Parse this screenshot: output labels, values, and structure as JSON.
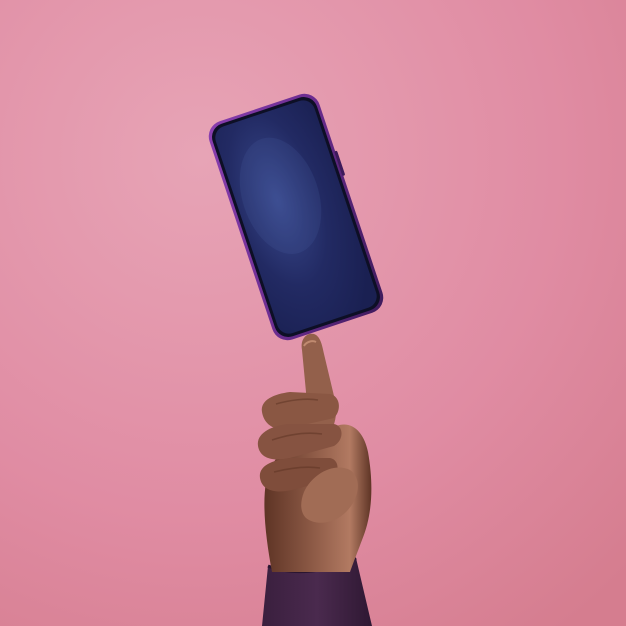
{
  "scene": {
    "background_color": "#e08ca3",
    "background_highlight": "#e7a4b6",
    "background_shadow": "#d57d8f",
    "phone_frame_color": "#6b2c8f",
    "phone_screen_color": "#1a2052",
    "phone_screen_highlight": "#3a4a8e",
    "skin_color": "#8d5a46",
    "skin_shadow": "#5e3425",
    "skin_highlight": "#b27a62",
    "sleeve_color": "#4a2a4e",
    "icons": [
      "smartphone",
      "hand",
      "sleeve"
    ]
  }
}
